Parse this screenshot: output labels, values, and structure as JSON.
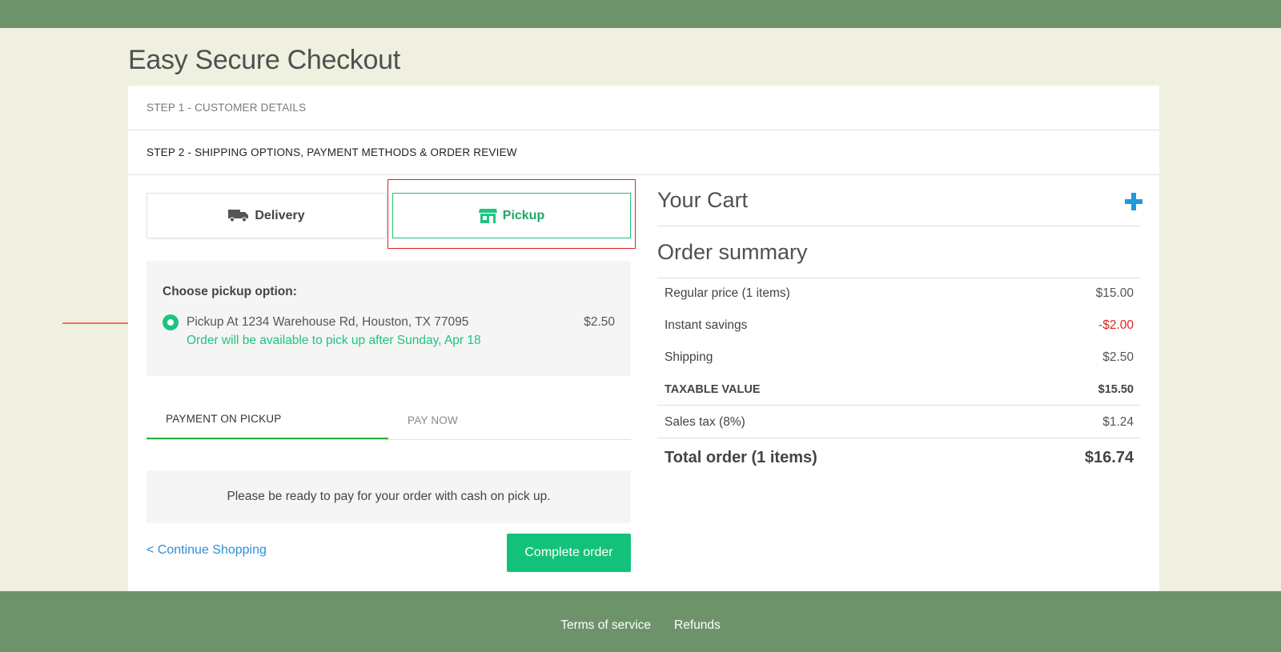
{
  "page": {
    "title": "Easy Secure Checkout"
  },
  "steps": {
    "step1": "STEP 1 - CUSTOMER DETAILS",
    "step2": "STEP 2 - SHIPPING OPTIONS, PAYMENT METHODS & ORDER REVIEW"
  },
  "shipping_tabs": [
    {
      "label": "Delivery",
      "icon": "truck-icon",
      "selected": false
    },
    {
      "label": "Pickup",
      "icon": "store-icon",
      "selected": true
    }
  ],
  "pickup": {
    "heading": "Choose pickup option:",
    "option": {
      "address": "Pickup At 1234 Warehouse Rd, Houston, TX 77095",
      "price": "$2.50",
      "note": "Order will be available to pick up after Sunday, Apr 18",
      "selected": true
    }
  },
  "payment_tabs": [
    {
      "label": "PAYMENT ON PICKUP",
      "active": true
    },
    {
      "label": "PAY NOW",
      "active": false
    }
  ],
  "payment_note": "Please be ready to pay for your order with cash on pick up.",
  "actions": {
    "continue_label": "< Continue Shopping",
    "complete_label": "Complete order"
  },
  "cart": {
    "title": "Your Cart",
    "add_icon": "plus-icon"
  },
  "summary": {
    "title": "Order summary",
    "rows": [
      {
        "label": "Regular price (1 items)",
        "value": "$15.00"
      },
      {
        "label": "Instant savings",
        "value": "-$2.00"
      },
      {
        "label": "Shipping",
        "value": "$2.50"
      },
      {
        "label": "TAXABLE VALUE",
        "value": "$15.50"
      },
      {
        "label": "Sales tax (8%)",
        "value": "$1.24"
      }
    ],
    "total_label": "Total order (1 items)",
    "total_value": "$16.74"
  },
  "footer": {
    "links": [
      "Terms of service",
      "Refunds"
    ]
  },
  "colors": {
    "header_footer": "#6d936b",
    "background": "#f0f0e0",
    "accent_green": "#13c27a",
    "link_blue": "#2d8fd6",
    "negative_red": "#e32222",
    "highlight_red": "#e32222"
  }
}
